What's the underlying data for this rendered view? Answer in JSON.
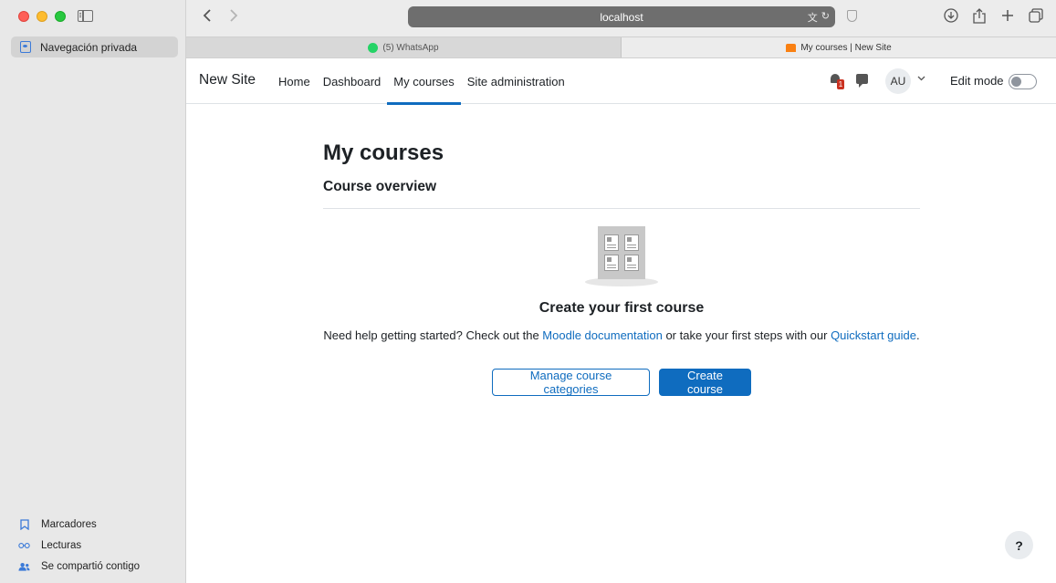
{
  "browser": {
    "url": "localhost",
    "sidebar": {
      "active_item": "Navegación privada",
      "bottom_items": [
        "Marcadores",
        "Lecturas",
        "Se compartió contigo"
      ]
    },
    "tabs": [
      {
        "title": "(5) WhatsApp",
        "active": false
      },
      {
        "title": "My courses | New Site",
        "active": true
      }
    ]
  },
  "moodle": {
    "site_name": "New Site",
    "nav": [
      "Home",
      "Dashboard",
      "My courses",
      "Site administration"
    ],
    "active_nav": "My courses",
    "notifications_count": "1",
    "user_initials": "AU",
    "edit_mode_label": "Edit mode",
    "edit_mode_on": false,
    "page_title": "My courses",
    "section_title": "Course overview",
    "empty_title": "Create your first course",
    "help_prefix": "Need help getting started? Check out the ",
    "help_link1": "Moodle documentation",
    "help_middle": " or take your first steps with our ",
    "help_link2": "Quickstart guide",
    "help_suffix": ".",
    "btn_manage": "Manage course categories",
    "btn_create": "Create course",
    "help_button": "?"
  },
  "colors": {
    "accent": "#0f6cbf",
    "badge": "#ca3120"
  }
}
